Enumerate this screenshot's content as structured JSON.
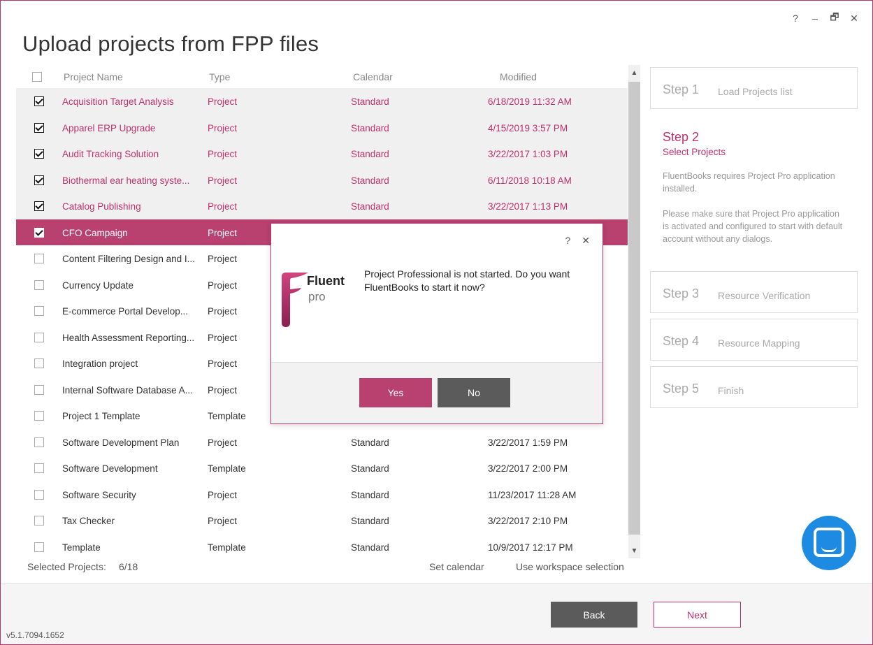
{
  "window": {
    "title": "Upload projects from FPP files",
    "controls": {
      "help": "?",
      "minimize": "–",
      "restore": "🗗",
      "close": "✕"
    }
  },
  "table": {
    "headers": {
      "name": "Project Name",
      "type": "Type",
      "calendar": "Calendar",
      "modified": "Modified"
    },
    "rows": [
      {
        "checked": true,
        "name": "Acquisition Target Analysis",
        "type": "Project",
        "calendar": "Standard",
        "modified": "6/18/2019 11:32 AM"
      },
      {
        "checked": true,
        "name": "Apparel ERP Upgrade",
        "type": "Project",
        "calendar": "Standard",
        "modified": "4/15/2019 3:57 PM"
      },
      {
        "checked": true,
        "name": "Audit Tracking Solution",
        "type": "Project",
        "calendar": "Standard",
        "modified": "3/22/2017 1:03 PM"
      },
      {
        "checked": true,
        "name": "Biothermal ear heating syste...",
        "type": "Project",
        "calendar": "Standard",
        "modified": "6/11/2018 10:18 AM"
      },
      {
        "checked": true,
        "name": "Catalog Publishing",
        "type": "Project",
        "calendar": "Standard",
        "modified": "3/22/2017 1:13 PM"
      },
      {
        "checked": true,
        "name": "CFO Campaign",
        "type": "Project",
        "calendar": "",
        "modified": ""
      },
      {
        "checked": false,
        "name": "Content Filtering Design and I...",
        "type": "Project",
        "calendar": "",
        "modified": ""
      },
      {
        "checked": false,
        "name": "Currency Update",
        "type": "Project",
        "calendar": "",
        "modified": ""
      },
      {
        "checked": false,
        "name": "E-commerce Portal Develop...",
        "type": "Project",
        "calendar": "",
        "modified": ""
      },
      {
        "checked": false,
        "name": "Health Assessment Reporting...",
        "type": "Project",
        "calendar": "",
        "modified": ""
      },
      {
        "checked": false,
        "name": "Integration project",
        "type": "Project",
        "calendar": "",
        "modified": ""
      },
      {
        "checked": false,
        "name": "Internal Software Database A...",
        "type": "Project",
        "calendar": "",
        "modified": ""
      },
      {
        "checked": false,
        "name": "Project 1 Template",
        "type": "Template",
        "calendar": "",
        "modified": ""
      },
      {
        "checked": false,
        "name": "Software Development Plan",
        "type": "Project",
        "calendar": "Standard",
        "modified": "3/22/2017 1:59 PM"
      },
      {
        "checked": false,
        "name": "Software Development",
        "type": "Template",
        "calendar": "Standard",
        "modified": "3/22/2017 2:00 PM"
      },
      {
        "checked": false,
        "name": "Software Security",
        "type": "Project",
        "calendar": "Standard",
        "modified": "11/23/2017 11:28 AM"
      },
      {
        "checked": false,
        "name": "Tax Checker",
        "type": "Project",
        "calendar": "Standard",
        "modified": "3/22/2017 2:10 PM"
      },
      {
        "checked": false,
        "name": "Template",
        "type": "Template",
        "calendar": "Standard",
        "modified": "10/9/2017 12:17 PM"
      }
    ]
  },
  "footer": {
    "selected_label": "Selected Projects:",
    "selected_count": "6/18",
    "set_calendar": "Set calendar",
    "use_workspace": "Use workspace selection"
  },
  "steps": {
    "step1": {
      "num": "Step 1",
      "label": "Load Projects list"
    },
    "step2": {
      "num": "Step 2",
      "label": "Select Projects",
      "desc1": "FluentBooks requires Project Pro application installed.",
      "desc2": "Please make sure that Project Pro application is activated and configured to start with default account without any dialogs."
    },
    "step3": {
      "num": "Step 3",
      "label": "Resource Verification"
    },
    "step4": {
      "num": "Step 4",
      "label": "Resource Mapping"
    },
    "step5": {
      "num": "Step 5",
      "label": "Finish"
    }
  },
  "buttons": {
    "back": "Back",
    "next": "Next"
  },
  "version": "v5.1.7094.1652",
  "dialog": {
    "help": "?",
    "close": "✕",
    "message": "Project Professional is not started. Do you want FluentBooks to start it now?",
    "logo_word1": "Fluent",
    "logo_word2": "pro",
    "yes": "Yes",
    "no": "No"
  },
  "colors": {
    "accent": "#b8416f",
    "accent_text": "#c0306a",
    "dark_button": "#5b5b5b",
    "chat": "#1e8be3"
  }
}
